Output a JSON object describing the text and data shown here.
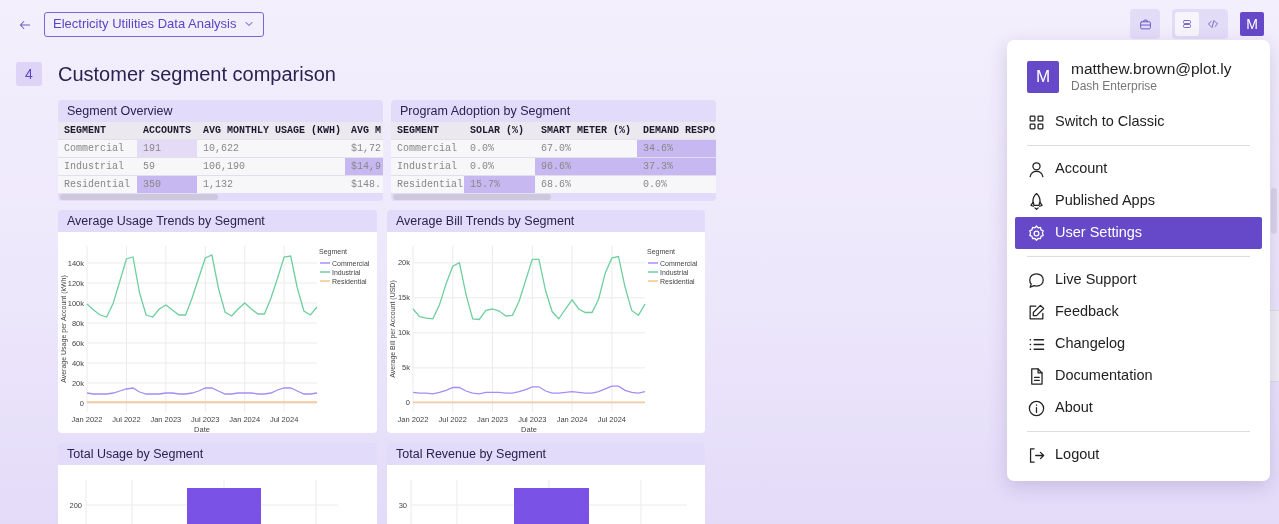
{
  "header": {
    "app_title": "Electricity Utilities Data Analysis",
    "view_toggle": [
      {
        "selected": true
      },
      {
        "selected": false
      }
    ],
    "avatar": "M"
  },
  "section": {
    "number": "4",
    "title": "Customer segment comparison"
  },
  "tables": [
    {
      "title": "Segment Overview",
      "columns": [
        "SEGMENT",
        "ACCOUNTS",
        "AVG MONTHLY USAGE (KWH)",
        "AVG M"
      ],
      "rows": [
        [
          {
            "text": "Commercial"
          },
          {
            "text": "191",
            "color": "#e4dcf7"
          },
          {
            "text": "10,622"
          },
          {
            "text": "$1,72"
          }
        ],
        [
          {
            "text": "Industrial"
          },
          {
            "text": "59"
          },
          {
            "text": "106,190"
          },
          {
            "text": "$14,9",
            "color": "#c8b8f1"
          }
        ],
        [
          {
            "text": "Residential"
          },
          {
            "text": "350",
            "color": "#c8b8f1"
          },
          {
            "text": "1,132"
          },
          {
            "text": "$148."
          }
        ]
      ]
    },
    {
      "title": "Program Adoption by Segment",
      "columns": [
        "SEGMENT",
        "SOLAR (%)",
        "SMART METER (%)",
        "DEMAND RESPO"
      ],
      "rows": [
        [
          {
            "text": "Commercial"
          },
          {
            "text": "0.0%"
          },
          {
            "text": "67.0%"
          },
          {
            "text": "34.6%",
            "color": "#c8b8f1"
          }
        ],
        [
          {
            "text": "Industrial"
          },
          {
            "text": "0.0%"
          },
          {
            "text": "96.6%",
            "color": "#c8b8f1"
          },
          {
            "text": "37.3%",
            "color": "#c8b8f1"
          }
        ],
        [
          {
            "text": "Residential"
          },
          {
            "text": "15.7%",
            "color": "#c8b8f1"
          },
          {
            "text": "68.6%"
          },
          {
            "text": "0.0%"
          }
        ]
      ]
    }
  ],
  "line_charts": [
    {
      "title": "Average Usage Trends by Segment",
      "chart_data": {
        "type": "line",
        "xlabel": "Date",
        "ylabel": "Average Usage per Account (kWh)",
        "grid": true,
        "legend": {
          "title": "Segment"
        },
        "x": [
          "2022-01",
          "2022-02",
          "2022-03",
          "2022-04",
          "2022-05",
          "2022-06",
          "2022-07",
          "2022-08",
          "2022-09",
          "2022-10",
          "2022-11",
          "2022-12",
          "2023-01",
          "2023-02",
          "2023-03",
          "2023-04",
          "2023-05",
          "2023-06",
          "2023-07",
          "2023-08",
          "2023-09",
          "2023-10",
          "2023-11",
          "2023-12",
          "2024-01",
          "2024-02",
          "2024-03",
          "2024-04",
          "2024-05",
          "2024-06",
          "2024-07",
          "2024-08",
          "2024-09",
          "2024-10",
          "2024-11",
          "2024-12"
        ],
        "xlim": [
          "2022-01",
          "2024-12"
        ],
        "ylim": [
          -9000,
          157000
        ],
        "xticks": [
          {
            "value": "2022-01",
            "label": "Jan 2022"
          },
          {
            "value": "2022-07",
            "label": "Jul 2022"
          },
          {
            "value": "2023-01",
            "label": "Jan 2023"
          },
          {
            "value": "2023-07",
            "label": "Jul 2023"
          },
          {
            "value": "2024-01",
            "label": "Jan 2024"
          },
          {
            "value": "2024-07",
            "label": "Jul 2024"
          }
        ],
        "yticks": [
          {
            "value": 0,
            "label": "0"
          },
          {
            "value": 20000,
            "label": "20k"
          },
          {
            "value": 40000,
            "label": "40k"
          },
          {
            "value": 60000,
            "label": "60k"
          },
          {
            "value": 80000,
            "label": "80k"
          },
          {
            "value": 100000,
            "label": "100k"
          },
          {
            "value": 120000,
            "label": "120k"
          },
          {
            "value": 140000,
            "label": "140k"
          }
        ],
        "series": [
          {
            "name": "Commercial",
            "color": "#a68cf5",
            "values": [
              10000,
              9000,
              9000,
              9000,
              10000,
              12000,
              14000,
              15000,
              11000,
              9000,
              9000,
              9000,
              10000,
              10000,
              9000,
              9000,
              10000,
              12000,
              15000,
              15000,
              12000,
              9000,
              9000,
              10000,
              10000,
              10000,
              9000,
              9000,
              10000,
              13000,
              15000,
              15000,
              12000,
              9000,
              9000,
              10000
            ]
          },
          {
            "name": "Industrial",
            "color": "#6fcf9f",
            "values": [
              99000,
              93000,
              88000,
              86000,
              100000,
              122000,
              144000,
              146000,
              110000,
              88000,
              86000,
              94000,
              98000,
              93000,
              88000,
              88000,
              105000,
              125000,
              145000,
              148000,
              115000,
              91000,
              87000,
              94000,
              100000,
              94000,
              89000,
              89000,
              105000,
              125000,
              146000,
              147000,
              115000,
              92000,
              88000,
              96000
            ]
          },
          {
            "name": "Residential",
            "color": "#f9c38a",
            "values": [
              1000,
              1000,
              1000,
              1000,
              1000,
              1000,
              1000,
              1000,
              1000,
              1000,
              1000,
              1000,
              1000,
              1000,
              1000,
              1000,
              1000,
              1000,
              1000,
              1000,
              1000,
              1000,
              1000,
              1000,
              1000,
              1000,
              1000,
              1000,
              1000,
              1000,
              1000,
              1000,
              1000,
              1000,
              1000,
              1000
            ]
          }
        ]
      }
    },
    {
      "title": "Average Bill Trends by Segment",
      "chart_data": {
        "type": "line",
        "xlabel": "Date",
        "ylabel": "Average Bill per Account (USD)",
        "grid": true,
        "legend": {
          "title": "Segment"
        },
        "x": [
          "2022-01",
          "2022-02",
          "2022-03",
          "2022-04",
          "2022-05",
          "2022-06",
          "2022-07",
          "2022-08",
          "2022-09",
          "2022-10",
          "2022-11",
          "2022-12",
          "2023-01",
          "2023-02",
          "2023-03",
          "2023-04",
          "2023-05",
          "2023-06",
          "2023-07",
          "2023-08",
          "2023-09",
          "2023-10",
          "2023-11",
          "2023-12",
          "2024-01",
          "2024-02",
          "2024-03",
          "2024-04",
          "2024-05",
          "2024-06",
          "2024-07",
          "2024-08",
          "2024-09",
          "2024-10",
          "2024-11",
          "2024-12"
        ],
        "xlim": [
          "2022-01",
          "2024-12"
        ],
        "ylim": [
          -1300,
          22400
        ],
        "xticks": [
          {
            "value": "2022-01",
            "label": "Jan 2022"
          },
          {
            "value": "2022-07",
            "label": "Jul 2022"
          },
          {
            "value": "2023-01",
            "label": "Jan 2023"
          },
          {
            "value": "2023-07",
            "label": "Jul 2023"
          },
          {
            "value": "2024-01",
            "label": "Jan 2024"
          },
          {
            "value": "2024-07",
            "label": "Jul 2024"
          }
        ],
        "yticks": [
          {
            "value": 0,
            "label": "0"
          },
          {
            "value": 5000,
            "label": "5k"
          },
          {
            "value": 10000,
            "label": "10k"
          },
          {
            "value": 15000,
            "label": "15k"
          },
          {
            "value": 20000,
            "label": "20k"
          }
        ],
        "series": [
          {
            "name": "Commercial",
            "color": "#a68cf5",
            "values": [
              1500,
              1400,
              1400,
              1300,
              1500,
              1800,
              2200,
              2200,
              1700,
              1400,
              1300,
              1500,
              1500,
              1500,
              1400,
              1400,
              1600,
              1900,
              2300,
              2300,
              1700,
              1400,
              1400,
              1500,
              1600,
              1500,
              1400,
              1400,
              1600,
              2000,
              2400,
              2400,
              1800,
              1500,
              1400,
              1600
            ]
          },
          {
            "name": "Industrial",
            "color": "#6fcf9f",
            "values": [
              13400,
              12300,
              12100,
              12000,
              14000,
              17000,
              19500,
              20000,
              15500,
              12000,
              11900,
              13200,
              13400,
              13100,
              12400,
              12500,
              14500,
              17500,
              20500,
              20500,
              16000,
              13000,
              12000,
              13400,
              14700,
              13400,
              12900,
              12900,
              14800,
              18500,
              20700,
              20900,
              16500,
              13200,
              12500,
              14100
            ]
          },
          {
            "name": "Residential",
            "color": "#f9c38a",
            "values": [
              100,
              100,
              100,
              100,
              100,
              100,
              100,
              100,
              100,
              100,
              100,
              100,
              100,
              100,
              100,
              100,
              100,
              100,
              100,
              100,
              100,
              100,
              100,
              100,
              100,
              100,
              100,
              100,
              100,
              100,
              100,
              100,
              100,
              100,
              100,
              100
            ]
          }
        ]
      }
    }
  ],
  "bar_panels": [
    {
      "title": "Total Usage by Segment",
      "tick_labels": [
        "200"
      ]
    },
    {
      "title": "Total Revenue by Segment",
      "tick_labels": [
        "30"
      ]
    }
  ],
  "user_menu": {
    "avatar": "M",
    "email": "matthew.brown@plot.ly",
    "subtitle": "Dash Enterprise",
    "sections": [
      [
        {
          "label": "Switch to Classic",
          "selected": false
        }
      ],
      [
        {
          "label": "Account",
          "selected": false
        },
        {
          "label": "Published Apps",
          "selected": false
        },
        {
          "label": "User Settings",
          "selected": true
        }
      ],
      [
        {
          "label": "Live Support",
          "selected": false
        },
        {
          "label": "Feedback",
          "selected": false
        },
        {
          "label": "Changelog",
          "selected": false
        },
        {
          "label": "Documentation",
          "selected": false
        },
        {
          "label": "About",
          "selected": false
        }
      ],
      [
        {
          "label": "Logout",
          "selected": false
        }
      ]
    ]
  }
}
